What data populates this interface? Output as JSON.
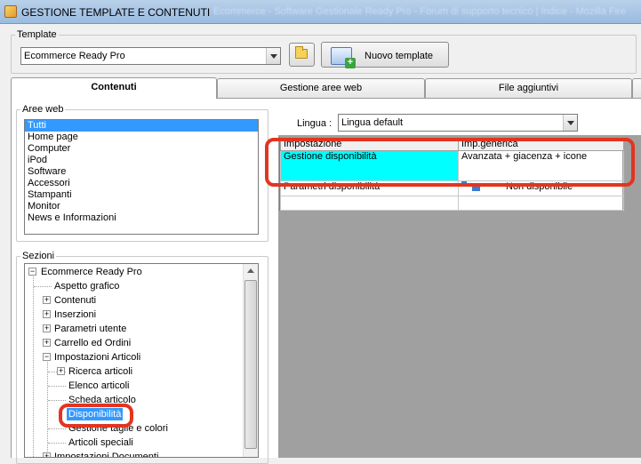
{
  "window": {
    "title": "GESTIONE TEMPLATE E CONTENUTI",
    "blurred_caption": "Ecommerce - Software Gestionale Ready Pro - Forum di supporto tecnico | Indice - Mozilla Fire"
  },
  "template_group": {
    "legend": "Template",
    "selected": "Ecommerce Ready Pro",
    "new_template_label": "Nuovo template"
  },
  "tabs": [
    {
      "label": "Contenuti",
      "active": true
    },
    {
      "label": "Gestione aree web",
      "active": false
    },
    {
      "label": "File aggiuntivi",
      "active": false
    }
  ],
  "aree_web": {
    "legend": "Aree web",
    "items": [
      "Tutti",
      "Home page",
      "Computer",
      "iPod",
      "Software",
      "Accessori",
      "Stampanti",
      "Monitor",
      "News e Informazioni"
    ],
    "selected_index": 0
  },
  "sezioni": {
    "legend": "Sezioni",
    "nodes": [
      "Ecommerce Ready Pro",
      "Aspetto grafico",
      "Contenuti",
      "Inserzioni",
      "Parametri utente",
      "Carrello ed Ordini",
      "Impostazioni Articoli",
      "Ricerca articoli",
      "Elenco articoli",
      "Scheda articolo",
      "Disponibilità",
      "Gestione taglie e colori",
      "Articoli speciali",
      "Impostazioni Documenti"
    ]
  },
  "lingua": {
    "label": "Lingua :",
    "selected": "Lingua default"
  },
  "grid": {
    "columns": [
      "Impostazione",
      "Imp.generica"
    ],
    "rows": [
      [
        "Gestione disponibilità",
        "Avanzata + giacenza + icone"
      ],
      [
        "Parametri disponibilità",
        "Non disponibile"
      ],
      [
        "",
        ""
      ]
    ]
  },
  "colors": {
    "highlight_ring": "#e3341f",
    "selection": "#3399ff",
    "selected_cell": "#00ffff"
  },
  "icons": [
    "folder-icon",
    "new-template-icon",
    "availability-icon"
  ]
}
